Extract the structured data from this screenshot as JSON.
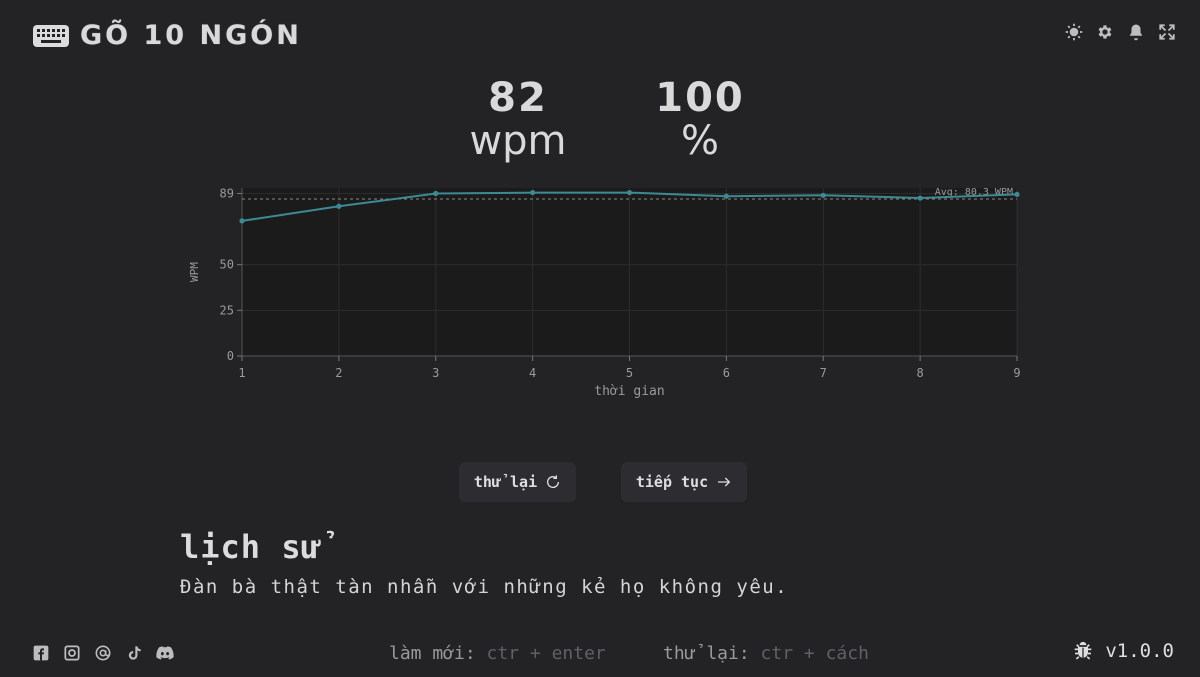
{
  "header": {
    "app_title": "GÕ 10 NGÓN",
    "icons": [
      "keyboard-icon",
      "brightness-icon",
      "settings-icon",
      "bell-icon",
      "fullscreen-icon"
    ]
  },
  "stats": {
    "wpm_value": "82",
    "wpm_unit": "wpm",
    "accuracy_value": "100",
    "accuracy_unit": "%"
  },
  "chart_data": {
    "type": "line",
    "x": [
      1,
      2,
      3,
      4,
      5,
      6,
      7,
      8,
      9
    ],
    "series": [
      {
        "values": [
          74,
          82,
          89,
          89.5,
          89.5,
          87.5,
          88,
          86.5,
          88.5
        ]
      }
    ],
    "average": {
      "value": 86,
      "label": "Avg: 80.3 WPM"
    },
    "xlabel": "thời gian",
    "ylabel": "WPM",
    "y_ticks": [
      "0",
      "25",
      "50",
      "89"
    ],
    "y_tick_values": [
      0,
      25,
      50,
      89
    ],
    "x_ticks": [
      "1",
      "2",
      "3",
      "4",
      "5",
      "6",
      "7",
      "8",
      "9"
    ],
    "ylim": [
      0,
      92
    ],
    "xlim": [
      1,
      9
    ],
    "grid": true,
    "colors": {
      "line": "#3d8a94",
      "avg": "#8a8a8a",
      "plot_bg": "#1b1b1c"
    }
  },
  "actions": {
    "retry_label": "thử lại",
    "next_label": "tiếp tục"
  },
  "history": {
    "title": "lịch sử",
    "quote": "Đàn bà thật tàn nhẫn với những kẻ họ không yêu."
  },
  "footer": {
    "socials": [
      "facebook-icon",
      "instagram-icon",
      "threads-icon",
      "tiktok-icon",
      "discord-icon"
    ],
    "shortcut_refresh_label": "làm mới:",
    "shortcut_refresh_keys": "ctr + enter",
    "shortcut_retry_label": "thử lại:",
    "shortcut_retry_keys": "ctr + cách",
    "version": "v1.0.0"
  },
  "colors": {
    "background": "#232326",
    "text": "#d4d4d4",
    "accent_line": "#3d8a94",
    "button_bg": "#2d2d31"
  }
}
